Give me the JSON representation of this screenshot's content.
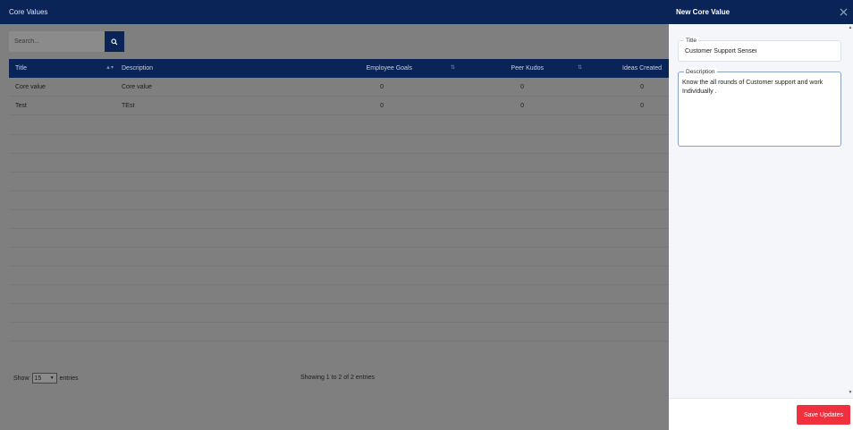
{
  "main": {
    "title": "Core Values",
    "search": {
      "placeholder": "Search...",
      "value": ""
    },
    "table": {
      "columns": [
        "Title",
        "Description",
        "Employee Goals",
        "Peer Kudos",
        "Ideas Created"
      ],
      "rows": [
        [
          "Core value",
          "Core value",
          "0",
          "0",
          "0"
        ],
        [
          "Test",
          "TEst",
          "0",
          "0",
          "0"
        ]
      ]
    },
    "footer": {
      "show_label": "Show",
      "page_size": "15",
      "entries_label": "entries",
      "info": "Showing 1 to 2 of 2 entries"
    }
  },
  "panel": {
    "title": "New Core Value",
    "title_field": {
      "label": "Title",
      "value": "Customer Support Sensei"
    },
    "description_field": {
      "label": "Description",
      "value": "Know the all rounds of Customer support and work Individually ."
    },
    "save_label": "Save Updates"
  },
  "colors": {
    "header": "#0a2457",
    "save": "#f0313d",
    "overlay": "#7f7f7f"
  },
  "icons": {
    "search": "search-icon",
    "close": "close-icon",
    "sort": "sort-icon",
    "dropdown": "chevron-down-icon"
  }
}
